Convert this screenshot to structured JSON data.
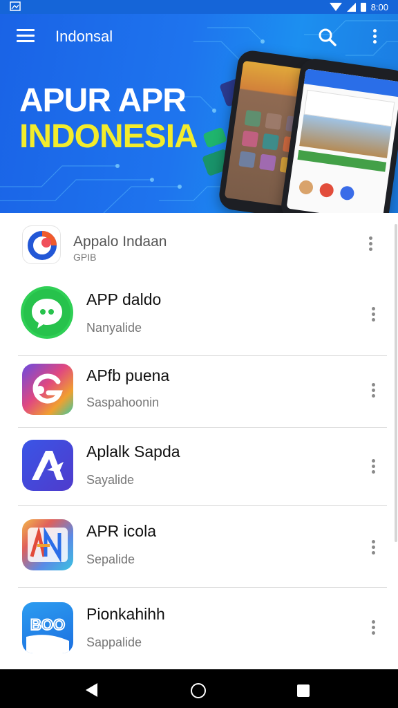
{
  "status_bar": {
    "time": "8:00",
    "left_icon": "image-notification-icon",
    "right_icons": [
      "wifi-icon",
      "signal-icon",
      "battery-icon"
    ]
  },
  "toolbar": {
    "title": "Indonsal",
    "menu_icon": "hamburger-menu-icon",
    "search_icon": "search-icon",
    "more_icon": "more-vertical-icon"
  },
  "banner": {
    "headline_line1": "APUR APR",
    "headline_line2": "INDONESIA",
    "colors": {
      "background": "#1a63e6",
      "headline1": "#ffffff",
      "headline2": "#f2ec2c"
    }
  },
  "apps": [
    {
      "title": "Appalo Indaan",
      "subtitle": "GPIB",
      "icon": "app-logo-g-icon"
    },
    {
      "title": "APP daldo",
      "subtitle": "Nanyalide",
      "icon": "chat-bubble-icon"
    },
    {
      "title": "APfb puena",
      "subtitle": "Saspahoonin",
      "icon": "gradient-g-icon"
    },
    {
      "title": "Aplalk Sapda",
      "subtitle": "Sayalide",
      "icon": "letter-a-icon"
    },
    {
      "title": "APR icola",
      "subtitle": "Sepalide",
      "icon": "letters-an-icon"
    },
    {
      "title": "Pionkahihh",
      "subtitle": "Sappalide",
      "icon": "boo-logo-icon"
    }
  ],
  "nav_bar": {
    "back_icon": "back-triangle-icon",
    "home_icon": "home-circle-icon",
    "recent_icon": "recent-square-icon"
  }
}
